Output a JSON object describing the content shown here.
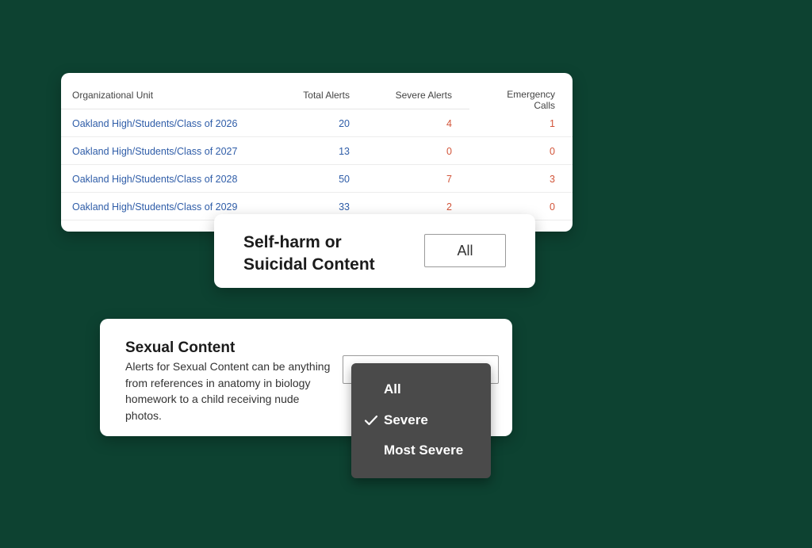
{
  "table": {
    "headers": {
      "unit": "Organizational Unit",
      "total": "Total Alerts",
      "severe": "Severe Alerts",
      "emergency": "Emergency Calls"
    },
    "rows": [
      {
        "unit": "Oakland High/Students/Class of 2026",
        "total": "20",
        "severe": "4",
        "emergency": "1"
      },
      {
        "unit": "Oakland High/Students/Class of 2027",
        "total": "13",
        "severe": "0",
        "emergency": "0"
      },
      {
        "unit": "Oakland High/Students/Class of 2028",
        "total": "50",
        "severe": "7",
        "emergency": "3"
      },
      {
        "unit": "Oakland High/Students/Class of 2029",
        "total": "33",
        "severe": "2",
        "emergency": "0"
      }
    ]
  },
  "selfharm": {
    "title_line1": "Self-harm or",
    "title_line2": "Suicidal Content",
    "selected": "All"
  },
  "sexual": {
    "title": "Sexual Content",
    "description": "Alerts for Sexual Content can be anything from references in anatomy in biology homework to a child receiving nude photos."
  },
  "dropdown": {
    "options": [
      "All",
      "Severe",
      "Most Severe"
    ],
    "checked": "Severe",
    "check_icon": "check-icon"
  },
  "colors": {
    "background": "#0d4231",
    "link_blue": "#2f5da8",
    "alert_red": "#d2553a",
    "menu_bg": "#4a4a4a"
  }
}
